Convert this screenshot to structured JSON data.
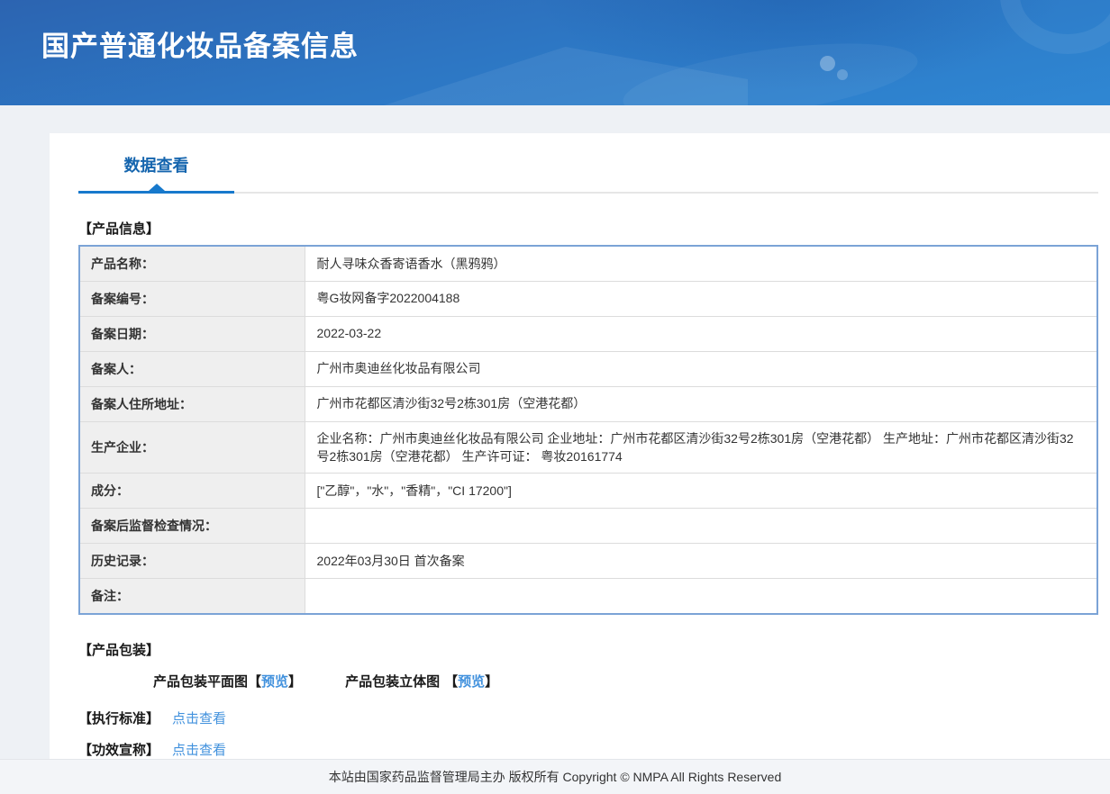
{
  "header": {
    "title": "国产普通化妆品备案信息"
  },
  "tabs": {
    "data_view": "数据查看"
  },
  "sections": {
    "product_info": "【产品信息】",
    "packaging": "【产品包装】",
    "standard": "【执行标准】",
    "efficacy": "【功效宣称】"
  },
  "table": {
    "rows": [
      {
        "label": "产品名称：",
        "value": "耐人寻味众香寄语香水（黑鸦鸦）"
      },
      {
        "label": "备案编号：",
        "value": "粤G妆网备字2022004188"
      },
      {
        "label": "备案日期：",
        "value": "2022-03-22"
      },
      {
        "label": "备案人：",
        "value": "广州市奥迪丝化妆品有限公司"
      },
      {
        "label": "备案人住所地址：",
        "value": "广州市花都区清沙街32号2栋301房（空港花都）"
      },
      {
        "label": "生产企业：",
        "value": "企业名称：广州市奥迪丝化妆品有限公司 企业地址：广州市花都区清沙街32号2栋301房（空港花都） 生产地址：广州市花都区清沙街32号2栋301房（空港花都） 生产许可证： 粤妆20161774"
      },
      {
        "label": "成分：",
        "value": "[\"乙醇\"，\"水\"，\"香精\"，\"CI 17200\"]"
      },
      {
        "label": "备案后监督检查情况：",
        "value": ""
      },
      {
        "label": "历史记录：",
        "value": "2022年03月30日 首次备案"
      },
      {
        "label": "备注：",
        "value": ""
      }
    ]
  },
  "packaging": {
    "flat_label": "产品包装平面图",
    "stereo_label": "产品包装立体图",
    "bracket_open": "【",
    "bracket_close": "】",
    "preview_link": "预览"
  },
  "links": {
    "view_label": "点击查看"
  },
  "footer": {
    "copyright": "本站由国家药品监督管理局主办 版权所有 Copyright © NMPA All Rights Reserved"
  },
  "colors": {
    "header_gradient_top": "#2c64b1",
    "header_gradient_bottom": "#2f87d3",
    "tab_accent": "#1779cc",
    "tab_text": "#1565ae",
    "link_blue": "#4191dd",
    "table_border": "#7ba3d6",
    "label_cell_bg": "#efefef",
    "page_bg": "#eef1f5",
    "footer_bg": "#f3f5f8"
  }
}
